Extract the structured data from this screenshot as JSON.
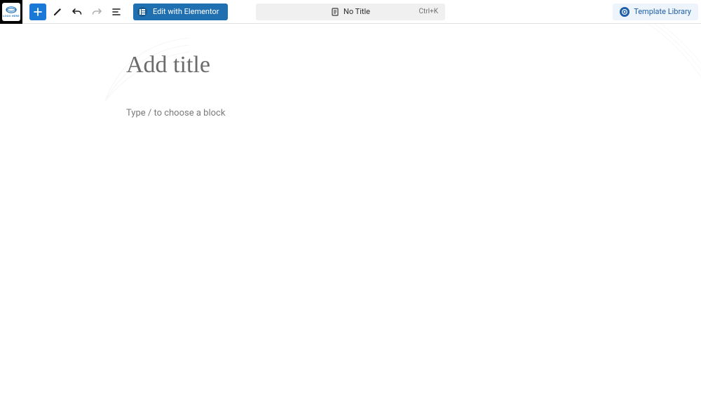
{
  "logo": {
    "text": "LOGO HERE"
  },
  "toolbar": {
    "elementor_label": "Edit with Elementor",
    "doc_title": "No Title",
    "shortcut": "Ctrl+K",
    "template_library_label": "Template Library"
  },
  "editor": {
    "title_placeholder": "Add title",
    "body_placeholder": "Type / to choose a block"
  }
}
